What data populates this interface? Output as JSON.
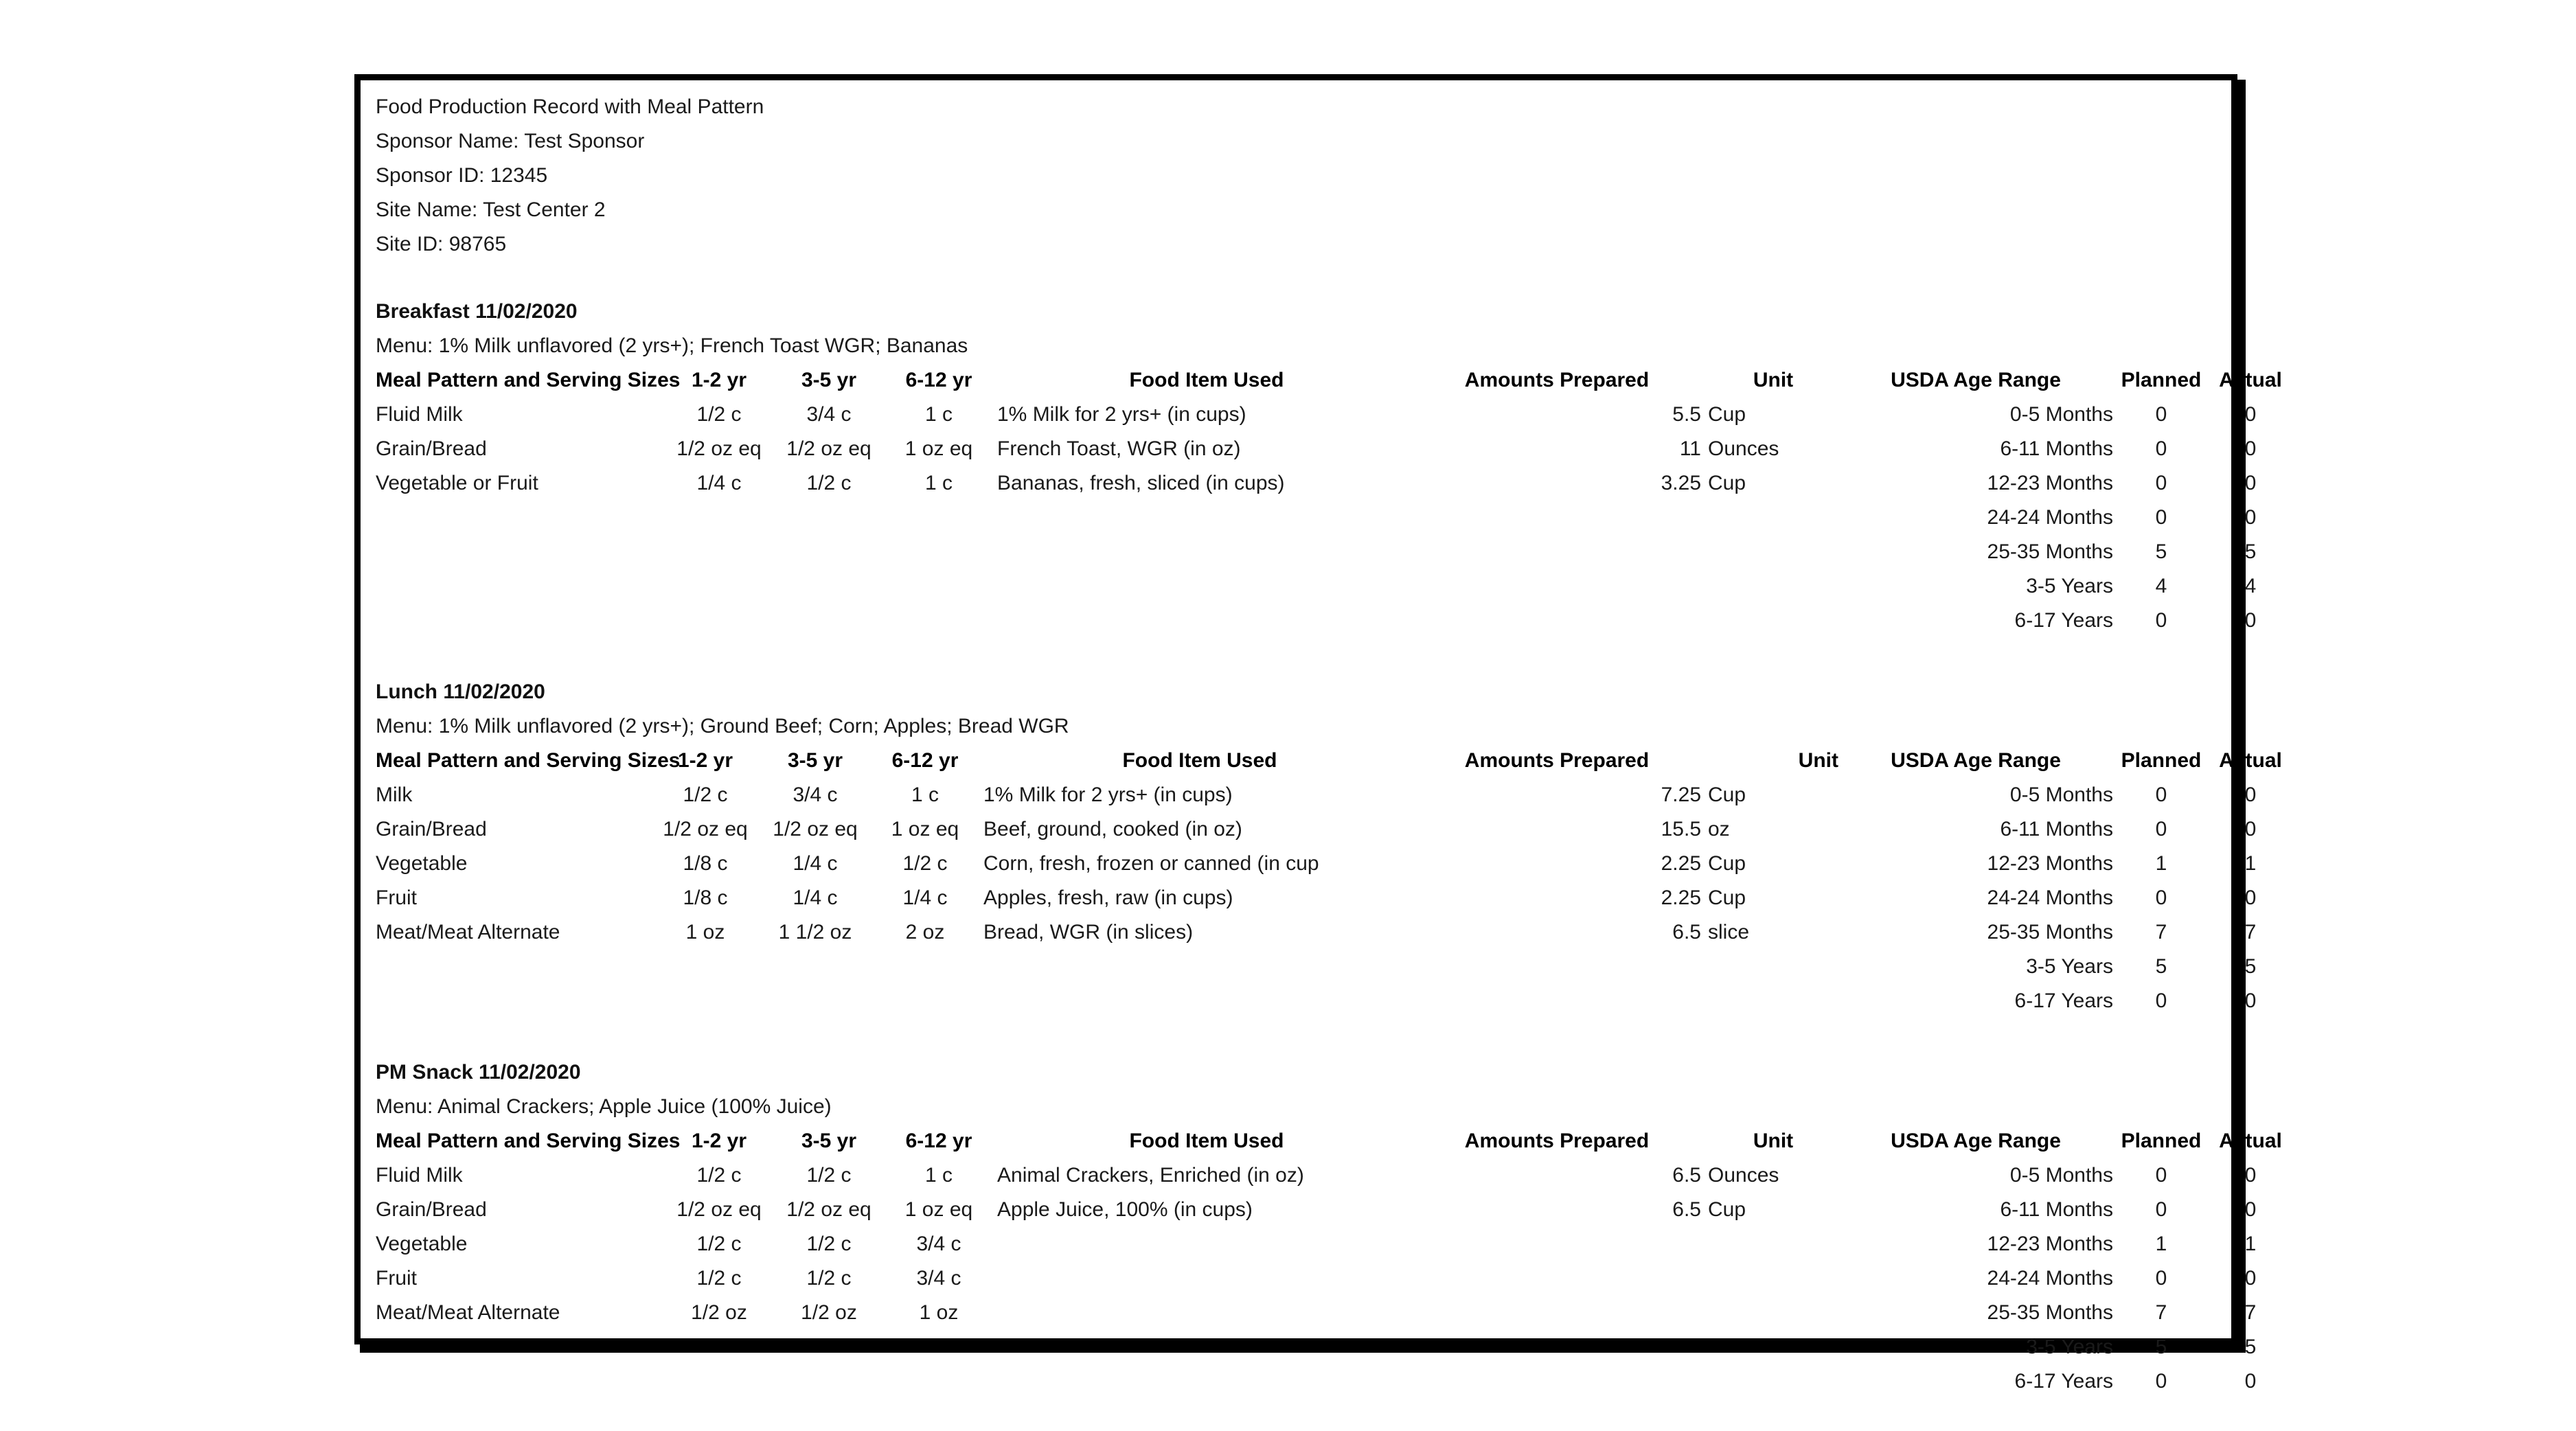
{
  "document": {
    "title": "Food Production Record with Meal Pattern",
    "meta": [
      "Sponsor Name: Test Sponsor",
      "Sponsor ID: 12345",
      "Site Name: Test Center 2",
      "Site ID: 98765"
    ]
  },
  "columns": {
    "pattern": "Meal Pattern and Serving Sizes",
    "age_1_2": "1-2 yr",
    "age_3_5": "3-5 yr",
    "age_6_12": "6-12 yr",
    "food_item": "Food Item Used",
    "amounts": "Amounts Prepared",
    "unit": "Unit",
    "usda_age_range": "USDA Age Range",
    "planned": "Planned",
    "actual": "Actual"
  },
  "meals": [
    {
      "title": "Breakfast 11/02/2020",
      "menu": "Menu: 1% Milk unflavored (2 yrs+); French Toast WGR; Bananas",
      "rows": [
        {
          "pattern": "Fluid Milk",
          "s1": "1/2 c",
          "s2": "3/4 c",
          "s3": "1 c",
          "food": "1% Milk for 2 yrs+ (in cups)",
          "amount": "5.5",
          "unit": "Cup",
          "age": "0-5 Months",
          "planned": "0",
          "actual": "0"
        },
        {
          "pattern": "Grain/Bread",
          "s1": "1/2 oz eq",
          "s2": "1/2 oz eq",
          "s3": "1 oz eq",
          "food": "French Toast, WGR (in oz)",
          "amount": "11",
          "unit": "Ounces",
          "age": "6-11 Months",
          "planned": "0",
          "actual": "0"
        },
        {
          "pattern": "Vegetable or Fruit",
          "s1": "1/4 c",
          "s2": "1/2 c",
          "s3": "1 c",
          "food": "Bananas, fresh, sliced (in cups)",
          "amount": "3.25",
          "unit": "Cup",
          "age": "12-23 Months",
          "planned": "0",
          "actual": "0"
        },
        {
          "pattern": "",
          "s1": "",
          "s2": "",
          "s3": "",
          "food": "",
          "amount": "",
          "unit": "",
          "age": "24-24 Months",
          "planned": "0",
          "actual": "0"
        },
        {
          "pattern": "",
          "s1": "",
          "s2": "",
          "s3": "",
          "food": "",
          "amount": "",
          "unit": "",
          "age": "25-35 Months",
          "planned": "5",
          "actual": "5"
        },
        {
          "pattern": "",
          "s1": "",
          "s2": "",
          "s3": "",
          "food": "",
          "amount": "",
          "unit": "",
          "age": "3-5 Years",
          "planned": "4",
          "actual": "4"
        },
        {
          "pattern": "",
          "s1": "",
          "s2": "",
          "s3": "",
          "food": "",
          "amount": "",
          "unit": "",
          "age": "6-17 Years",
          "planned": "0",
          "actual": "0"
        }
      ]
    },
    {
      "title": "Lunch 11/02/2020",
      "menu": "Menu: 1% Milk unflavored (2 yrs+); Ground Beef; Corn; Apples; Bread WGR",
      "rows": [
        {
          "pattern": "Milk",
          "s1": "1/2 c",
          "s2": "3/4 c",
          "s3": "1 c",
          "food": "1% Milk for 2 yrs+ (in cups)",
          "amount": "7.25",
          "unit": "Cup",
          "age": "0-5 Months",
          "planned": "0",
          "actual": "0"
        },
        {
          "pattern": "Grain/Bread",
          "s1": "1/2 oz eq",
          "s2": "1/2 oz eq",
          "s3": "1 oz eq",
          "food": "Beef, ground, cooked (in oz)",
          "amount": "15.5",
          "unit": "oz",
          "age": "6-11 Months",
          "planned": "0",
          "actual": "0"
        },
        {
          "pattern": "Vegetable",
          "s1": "1/8 c",
          "s2": "1/4 c",
          "s3": "1/2 c",
          "food": "Corn, fresh, frozen or canned (in cup",
          "amount": "2.25",
          "unit": "Cup",
          "age": "12-23 Months",
          "planned": "1",
          "actual": "1"
        },
        {
          "pattern": "Fruit",
          "s1": "1/8 c",
          "s2": "1/4 c",
          "s3": "1/4 c",
          "food": "Apples, fresh, raw (in cups)",
          "amount": "2.25",
          "unit": "Cup",
          "age": "24-24 Months",
          "planned": "0",
          "actual": "0"
        },
        {
          "pattern": "Meat/Meat Alternate",
          "s1": "1 oz",
          "s2": "1 1/2 oz",
          "s3": "2 oz",
          "food": "Bread, WGR (in slices)",
          "amount": "6.5",
          "unit": "slice",
          "age": "25-35 Months",
          "planned": "7",
          "actual": "7"
        },
        {
          "pattern": "",
          "s1": "",
          "s2": "",
          "s3": "",
          "food": "",
          "amount": "",
          "unit": "",
          "age": "3-5 Years",
          "planned": "5",
          "actual": "5"
        },
        {
          "pattern": "",
          "s1": "",
          "s2": "",
          "s3": "",
          "food": "",
          "amount": "",
          "unit": "",
          "age": "6-17 Years",
          "planned": "0",
          "actual": "0"
        }
      ]
    },
    {
      "title": "PM Snack 11/02/2020",
      "menu": "Menu: Animal Crackers; Apple Juice (100% Juice)",
      "rows": [
        {
          "pattern": "Fluid Milk",
          "s1": "1/2 c",
          "s2": "1/2 c",
          "s3": "1 c",
          "food": "Animal Crackers, Enriched (in oz)",
          "amount": "6.5",
          "unit": "Ounces",
          "age": "0-5 Months",
          "planned": "0",
          "actual": "0"
        },
        {
          "pattern": "Grain/Bread",
          "s1": "1/2 oz eq",
          "s2": "1/2 oz eq",
          "s3": "1 oz eq",
          "food": "Apple Juice, 100% (in cups)",
          "amount": "6.5",
          "unit": "Cup",
          "age": "6-11 Months",
          "planned": "0",
          "actual": "0"
        },
        {
          "pattern": "Vegetable",
          "s1": "1/2 c",
          "s2": "1/2 c",
          "s3": "3/4 c",
          "food": "",
          "amount": "",
          "unit": "",
          "age": "12-23 Months",
          "planned": "1",
          "actual": "1"
        },
        {
          "pattern": "Fruit",
          "s1": "1/2 c",
          "s2": "1/2 c",
          "s3": "3/4 c",
          "food": "",
          "amount": "",
          "unit": "",
          "age": "24-24 Months",
          "planned": "0",
          "actual": "0"
        },
        {
          "pattern": "Meat/Meat Alternate",
          "s1": "1/2 oz",
          "s2": "1/2 oz",
          "s3": "1 oz",
          "food": "",
          "amount": "",
          "unit": "",
          "age": "25-35 Months",
          "planned": "7",
          "actual": "7"
        },
        {
          "pattern": "",
          "s1": "",
          "s2": "",
          "s3": "",
          "food": "",
          "amount": "",
          "unit": "",
          "age": "3-5 Years",
          "planned": "5",
          "actual": "5"
        },
        {
          "pattern": "",
          "s1": "",
          "s2": "",
          "s3": "",
          "food": "",
          "amount": "",
          "unit": "",
          "age": "6-17 Years",
          "planned": "0",
          "actual": "0"
        }
      ]
    }
  ]
}
